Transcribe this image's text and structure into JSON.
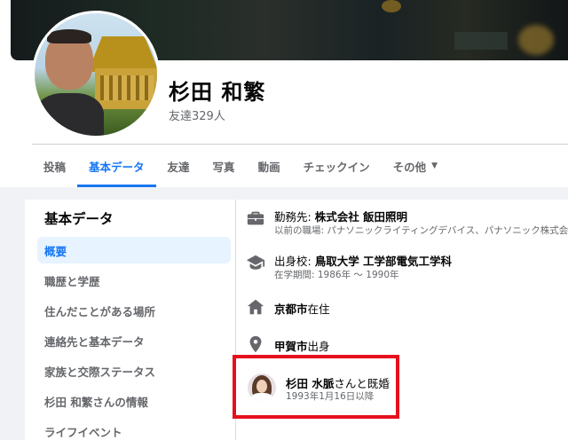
{
  "profile": {
    "name": "杉田 和繁",
    "friends": "友達329人"
  },
  "tabs": [
    {
      "label": "投稿"
    },
    {
      "label": "基本データ"
    },
    {
      "label": "友達"
    },
    {
      "label": "写真"
    },
    {
      "label": "動画"
    },
    {
      "label": "チェックイン"
    },
    {
      "label": "その他",
      "caret": "▼"
    }
  ],
  "sidebar": {
    "title": "基本データ",
    "items": [
      {
        "label": "概要"
      },
      {
        "label": "職歴と学歴"
      },
      {
        "label": "住んだことがある場所"
      },
      {
        "label": "連絡先と基本データ"
      },
      {
        "label": "家族と交際ステータス"
      },
      {
        "label": "杉田 和繁さんの情報"
      },
      {
        "label": "ライフイベント"
      }
    ]
  },
  "overview": {
    "work": {
      "prefix": "勤務先: ",
      "company": "株式会社 飯田照明",
      "sub": "以前の職場: パナソニックライティングデバイス、パナソニック株式会"
    },
    "education": {
      "prefix": "出身校: ",
      "school": "鳥取大学 工学部電気工学科",
      "sub": "在学期間: 1986年 〜 1990年"
    },
    "lives": {
      "city": "京都市",
      "suffix": "在住"
    },
    "from": {
      "city": "甲賀市",
      "suffix": "出身"
    },
    "relationship": {
      "partner": "杉田 水脈",
      "suffix": "さんと既婚",
      "since": "1993年1月16日以降"
    }
  },
  "colors": {
    "accent": "#1877f2",
    "highlight_border": "#e6101d",
    "icon_gray": "#65676b"
  },
  "icons": {
    "work": "briefcase-icon",
    "education": "graduation-cap-icon",
    "lives": "home-icon",
    "from": "location-pin-icon",
    "tab_more": "caret-down-icon"
  }
}
